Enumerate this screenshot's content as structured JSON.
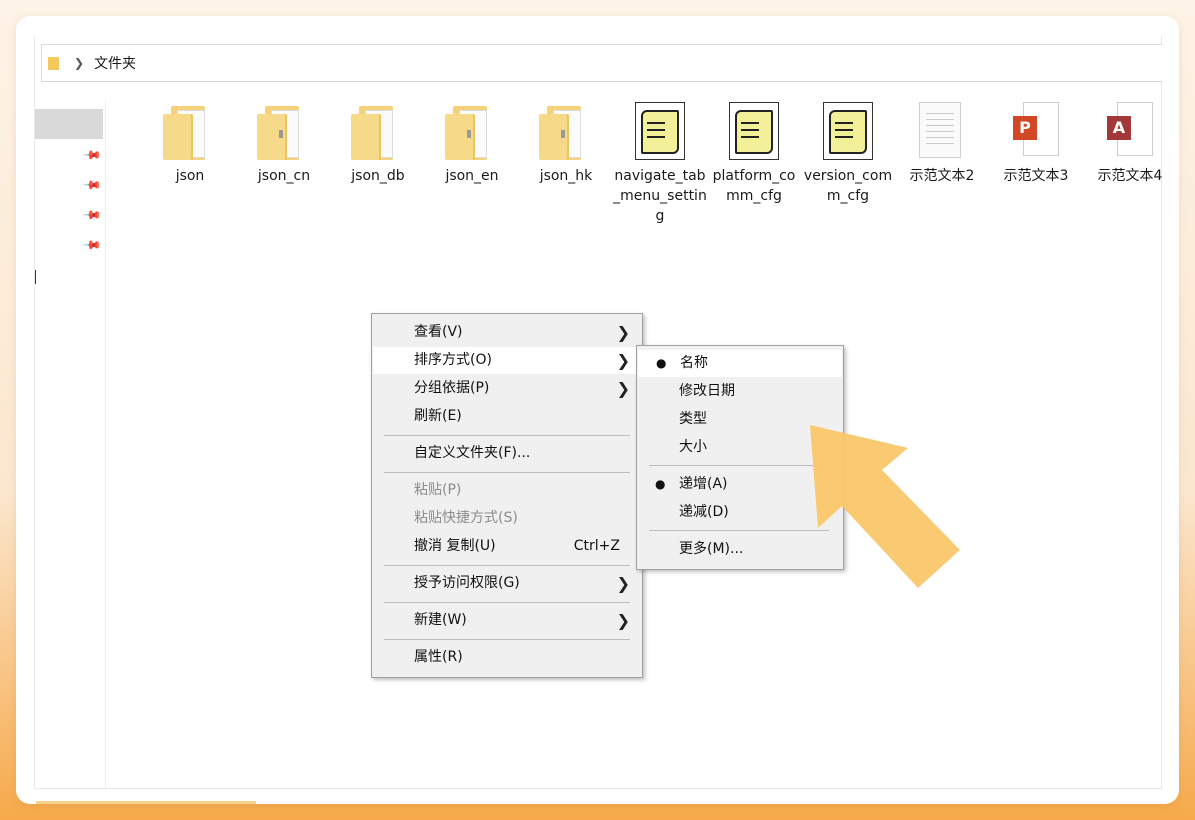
{
  "address": {
    "path": "文件夹"
  },
  "files": [
    {
      "type": "folder",
      "label": "json"
    },
    {
      "type": "folder",
      "label": "json_cn"
    },
    {
      "type": "folder",
      "label": "json_db"
    },
    {
      "type": "folder",
      "label": "json_en"
    },
    {
      "type": "folder",
      "label": "json_hk"
    },
    {
      "type": "script",
      "label": "navigate_tab_menu_setting"
    },
    {
      "type": "script",
      "label": "platform_comm_cfg"
    },
    {
      "type": "script",
      "label": "version_comm_cfg"
    },
    {
      "type": "text",
      "label": "示范文本2"
    },
    {
      "type": "powerpoint",
      "label": "示范文本3"
    },
    {
      "type": "access",
      "label": "示范文本4"
    }
  ],
  "context_menu": {
    "view": "查看(V)",
    "sort_by": "排序方式(O)",
    "group_by": "分组依据(P)",
    "refresh": "刷新(E)",
    "customize": "自定义文件夹(F)...",
    "paste": "粘贴(P)",
    "paste_shortcut": "粘贴快捷方式(S)",
    "undo": "撤消 复制(U)",
    "undo_shortcut": "Ctrl+Z",
    "give_access": "授予访问权限(G)",
    "new": "新建(W)",
    "properties": "属性(R)"
  },
  "sort_submenu": {
    "name": "名称",
    "date_modified": "修改日期",
    "type": "类型",
    "size": "大小",
    "ascending": "递增(A)",
    "descending": "递减(D)",
    "more": "更多(M)...",
    "selected_field": "名称",
    "selected_order": "递增(A)"
  },
  "colors": {
    "highlight_arrow": "#f9c76a",
    "ppt_badge": "#d24726",
    "access_badge": "#a4373a"
  }
}
